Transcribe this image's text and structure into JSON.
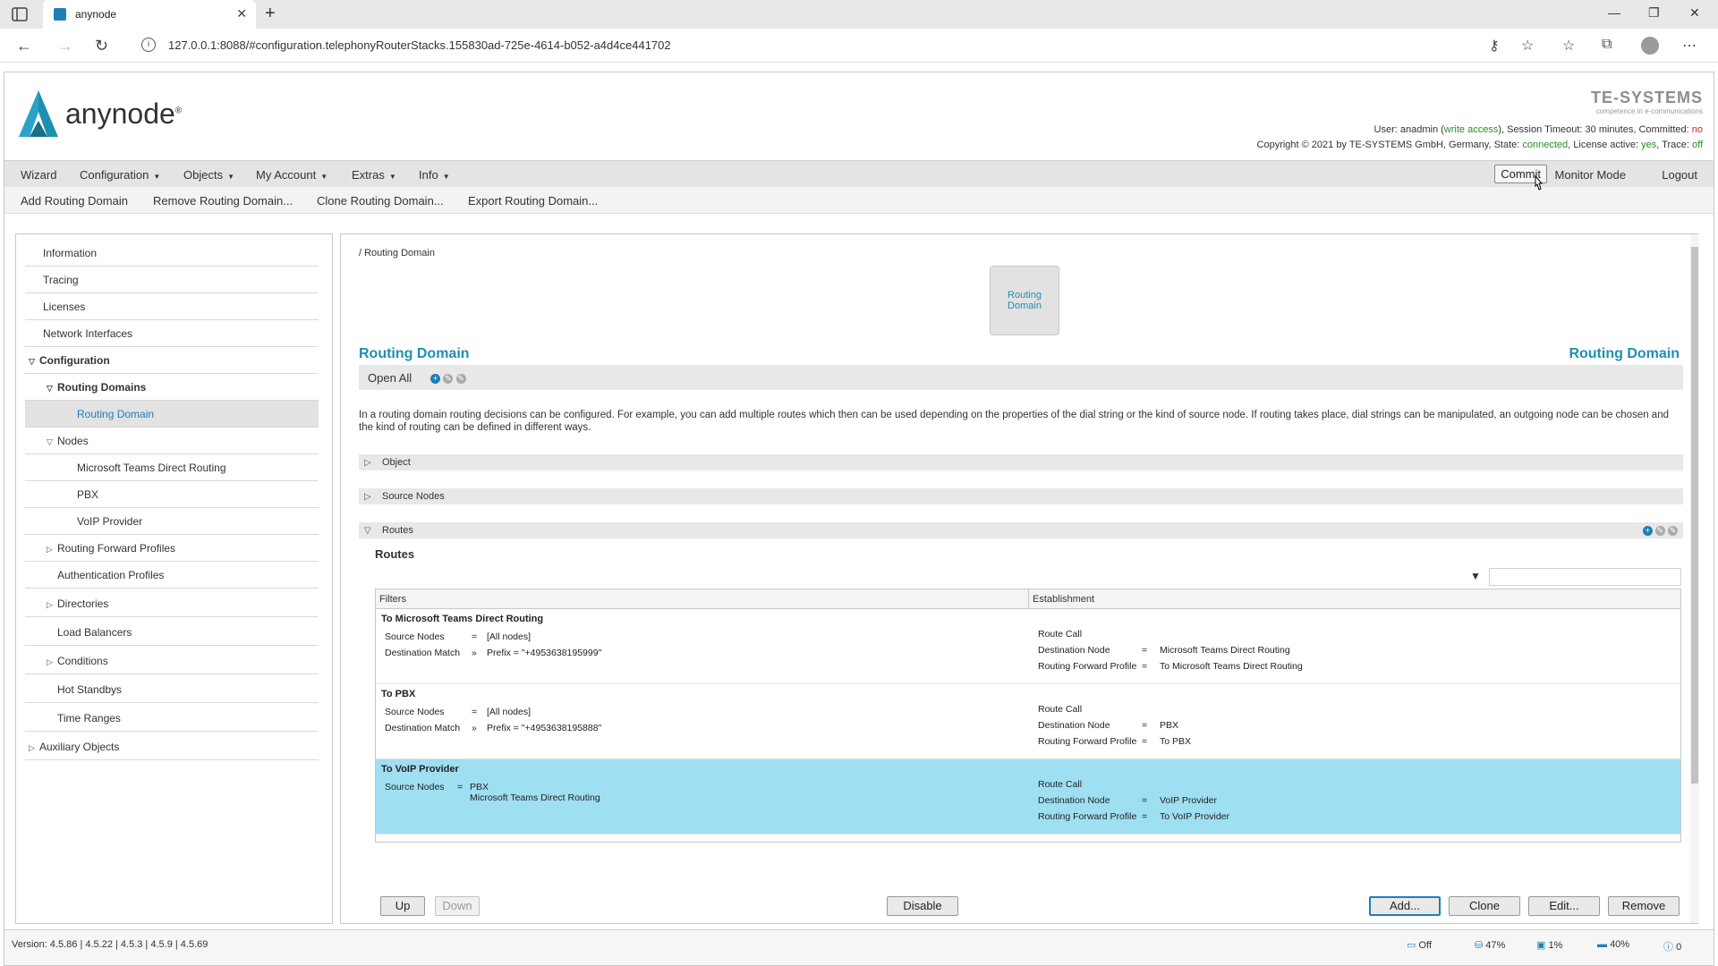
{
  "browser": {
    "tab_title": "anynode",
    "url": "127.0.0.1:8088/#configuration.telephonyRouterStacks.155830ad-725e-4614-b052-a4d4ce441702"
  },
  "header": {
    "logo_text": "anynode",
    "logo_mark": "®",
    "brand_name": "TE-SYSTEMS",
    "brand_slogan": "competence in e-communications",
    "status": {
      "user_prefix": "User: anadmin (",
      "access": "write access",
      "user_suffix": "), Session Timeout: 30 minutes, Committed: ",
      "committed": "no",
      "copyright_prefix": "Copyright © 2021 by TE-SYSTEMS GmbH, Germany, State: ",
      "state": "connected",
      "license_prefix": ", License active: ",
      "license": "yes",
      "trace_prefix": ", Trace: ",
      "trace": "off"
    }
  },
  "menu": {
    "wizard": "Wizard",
    "configuration": "Configuration",
    "objects": "Objects",
    "my_account": "My Account",
    "extras": "Extras",
    "info": "Info",
    "commit": "Commit",
    "monitor_mode": "Monitor Mode",
    "logout": "Logout"
  },
  "actions": {
    "add": "Add Routing Domain",
    "remove": "Remove Routing Domain...",
    "clone": "Clone Routing Domain...",
    "export": "Export Routing Domain..."
  },
  "tree": {
    "information": "Information",
    "tracing": "Tracing",
    "licenses": "Licenses",
    "network_interfaces": "Network Interfaces",
    "configuration": "Configuration",
    "routing_domains": "Routing Domains",
    "routing_domain": "Routing Domain",
    "nodes": "Nodes",
    "node_teams": "Microsoft Teams Direct Routing",
    "node_pbx": "PBX",
    "node_voip": "VoIP Provider",
    "routing_forward_profiles": "Routing Forward Profiles",
    "authentication_profiles": "Authentication Profiles",
    "directories": "Directories",
    "load_balancers": "Load Balancers",
    "conditions": "Conditions",
    "hot_standbys": "Hot Standbys",
    "time_ranges": "Time Ranges",
    "auxiliary_objects": "Auxiliary Objects"
  },
  "main": {
    "breadcrumb": "/ Routing Domain",
    "icon_label": "Routing Domain",
    "title_left": "Routing Domain",
    "title_right": "Routing Domain",
    "open_all": "Open All",
    "description": "In a routing domain routing decisions can be configured. For example, you can add multiple routes which then can be used depending on the properties of the dial string or the kind of source node. If routing takes place, dial strings can be manipulated, an outgoing node can be chosen and the kind of routing can be defined in different ways.",
    "section_object": "Object",
    "section_source_nodes": "Source Nodes",
    "section_routes": "Routes",
    "routes_title": "Routes",
    "col_filters": "Filters",
    "col_establishment": "Establishment",
    "routes": [
      {
        "name": "To Microsoft Teams Direct Routing",
        "src_label": "Source Nodes",
        "src_op": "=",
        "src_value": "[All nodes]",
        "dst_label": "Destination Match",
        "dst_op": "»",
        "dst_value": "Prefix = \"+4953638195999\"",
        "est_action": "Route Call",
        "est_node_label": "Destination Node",
        "est_node": "Microsoft Teams Direct Routing",
        "est_profile_label": "Routing Forward Profile",
        "est_profile": "To Microsoft Teams Direct Routing",
        "eq": "="
      },
      {
        "name": "To PBX",
        "src_label": "Source Nodes",
        "src_op": "=",
        "src_value": "[All nodes]",
        "dst_label": "Destination Match",
        "dst_op": "»",
        "dst_value": "Prefix = \"+4953638195888\"",
        "est_action": "Route Call",
        "est_node_label": "Destination Node",
        "est_node": "PBX",
        "est_profile_label": "Routing Forward Profile",
        "est_profile": "To PBX",
        "eq": "="
      },
      {
        "name": "To VoIP Provider",
        "src_label": "Source Nodes",
        "src_op": "=",
        "src_value": "PBX",
        "src_value2": "Microsoft Teams Direct Routing",
        "est_action": "Route Call",
        "est_node_label": "Destination Node",
        "est_node": "VoIP Provider",
        "est_profile_label": "Routing Forward Profile",
        "est_profile": "To VoIP Provider",
        "eq": "="
      }
    ],
    "buttons": {
      "up": "Up",
      "down": "Down",
      "disable": "Disable",
      "add": "Add...",
      "clone": "Clone",
      "edit": "Edit...",
      "remove": "Remove"
    }
  },
  "footer": {
    "version": "Version: 4.5.86 | 4.5.22 | 4.5.3 | 4.5.9 | 4.5.69",
    "trace": "Off",
    "mem": "47%",
    "cpu": "1%",
    "disk": "40%",
    "info": "0"
  },
  "colors": {
    "accent": "#1f8fb0",
    "selected_row": "#9fdff2",
    "menu_bg": "#e4e4e4"
  }
}
